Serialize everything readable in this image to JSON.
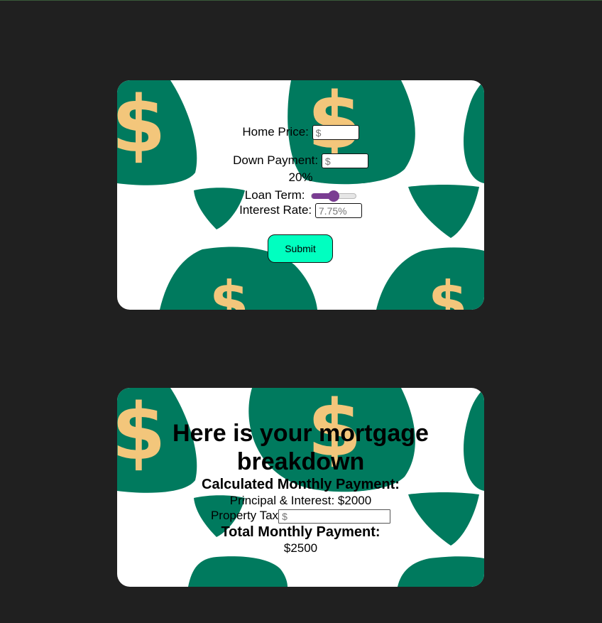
{
  "colors": {
    "page_background": "#202020",
    "bag_green": "#007a5e",
    "dollar_gold": "#f3c67b",
    "submit_background": "#00ffc0",
    "slider_accent": "#7a3d92"
  },
  "background_art": {
    "icon": "money-bag-icon"
  },
  "form": {
    "home_price_label": "Home Price:",
    "home_price_placeholder": "$",
    "down_payment_label": "Down Payment:",
    "down_payment_placeholder": "$",
    "down_payment_percent": "20%",
    "loan_term_label": "Loan Term:",
    "loan_term_level": 0.5,
    "interest_rate_label": "Interest Rate:",
    "interest_rate_placeholder": "7.75%",
    "submit_label": "Submit"
  },
  "results": {
    "heading": "Here is your mortgage breakdown",
    "calculated_label": "Calculated Monthly Payment:",
    "principal_interest": "Principal & Interest: $2000",
    "property_tax_label": "Property Tax",
    "property_tax_placeholder": "$",
    "total_label": "Total Monthly Payment:",
    "total_value": "$2500"
  }
}
